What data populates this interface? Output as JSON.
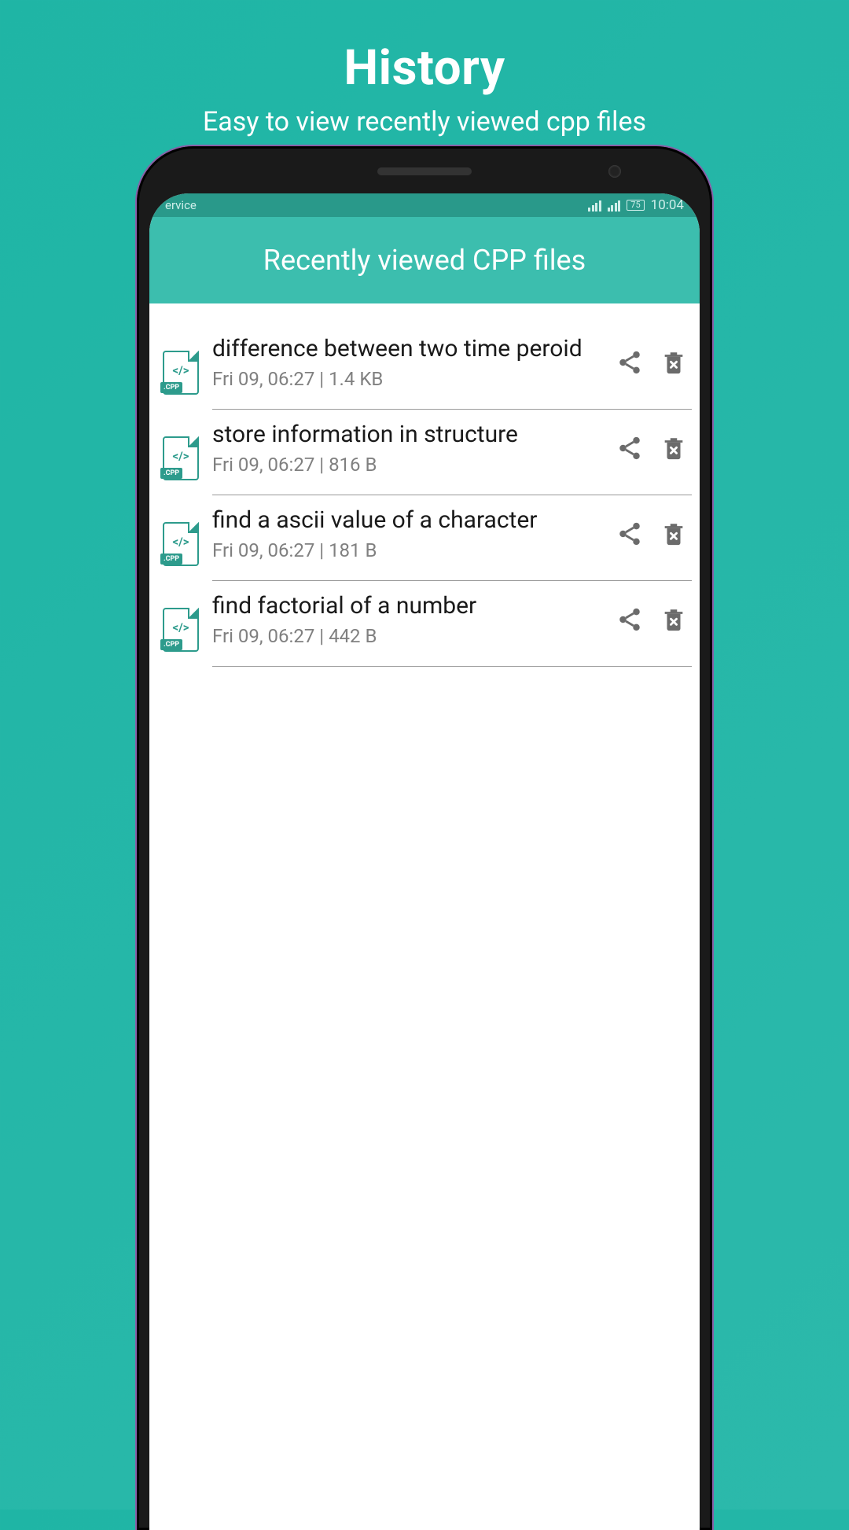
{
  "promo": {
    "title": "History",
    "subtitle": "Easy to view recently viewed cpp files"
  },
  "status": {
    "left_text": "ervice",
    "battery": "75",
    "time": "10:04"
  },
  "app_bar": {
    "title": "Recently viewed CPP files"
  },
  "file_icon": {
    "code_glyph": "</>",
    "ext_label": ".CPP"
  },
  "files": [
    {
      "title": "difference between two time peroid",
      "meta": "Fri 09, 06:27 | 1.4 KB"
    },
    {
      "title": "store information in structure",
      "meta": "Fri 09, 06:27 | 816 B"
    },
    {
      "title": "find a ascii value of a character",
      "meta": "Fri 09, 06:27 | 181 B"
    },
    {
      "title": "find factorial of a number",
      "meta": "Fri 09, 06:27 | 442 B"
    }
  ]
}
